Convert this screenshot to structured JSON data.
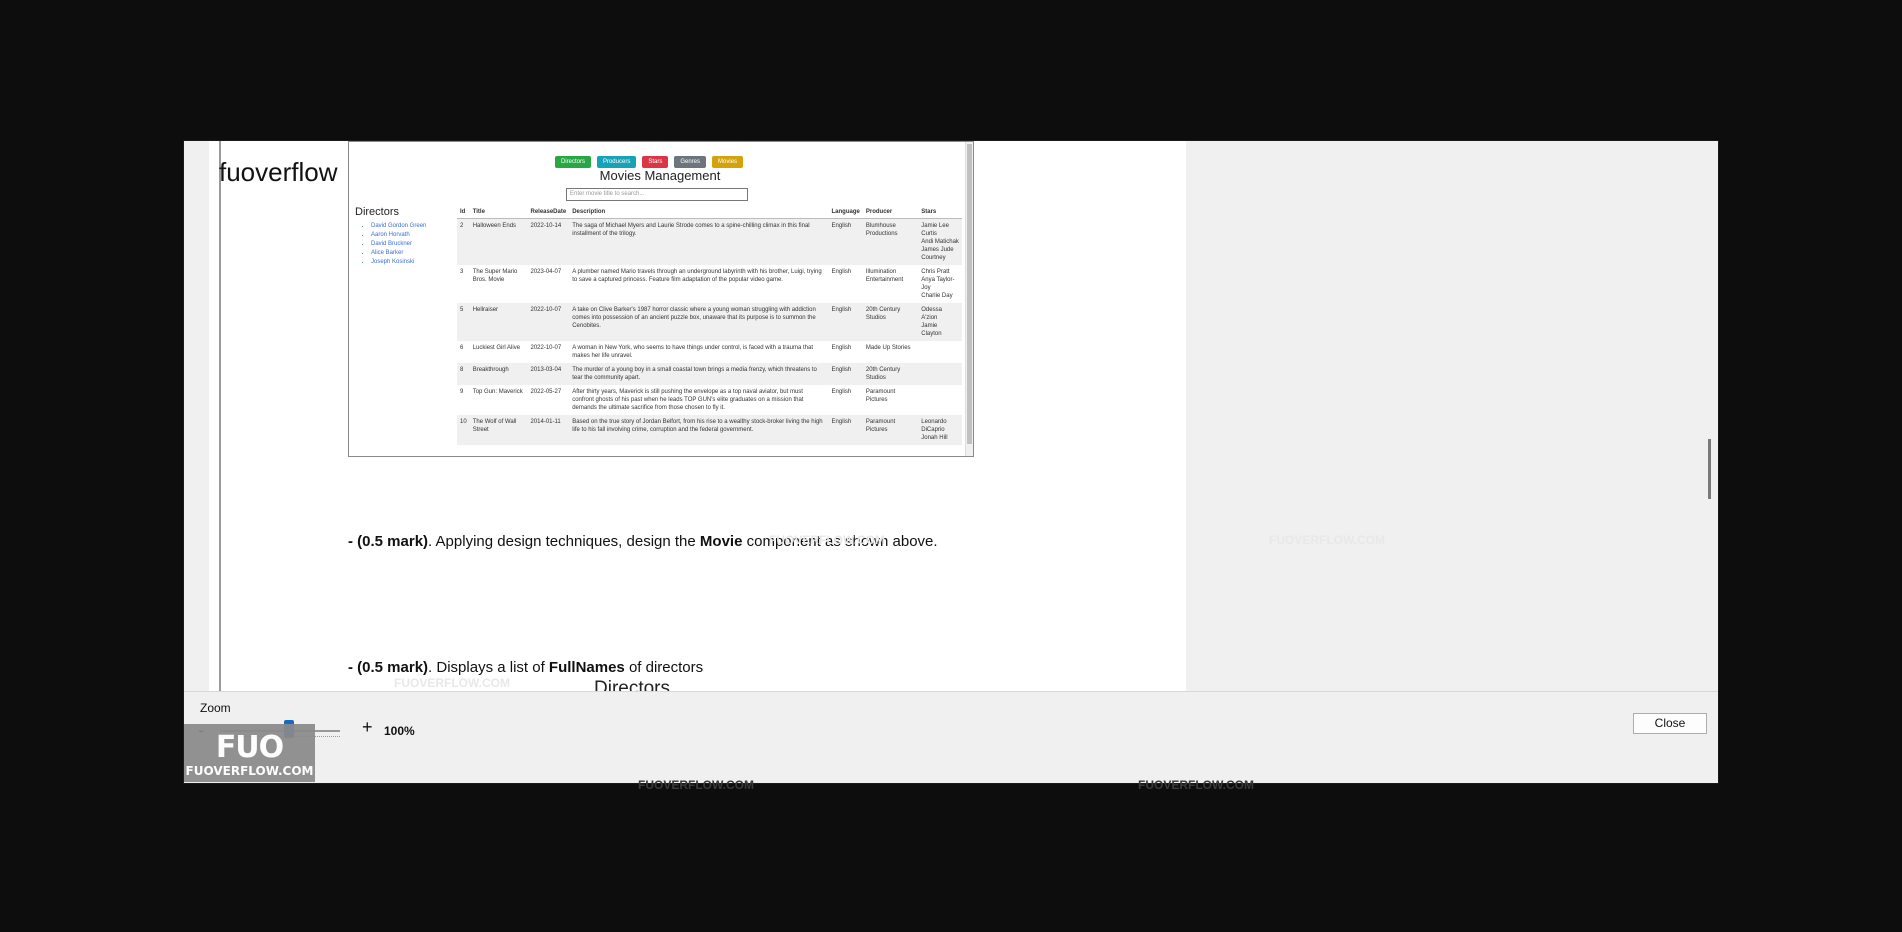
{
  "app": {
    "title": "fuoverflow"
  },
  "screenshot": {
    "nav_buttons": [
      {
        "label": "Directors",
        "color": "#28a745"
      },
      {
        "label": "Producers",
        "color": "#17a2b8"
      },
      {
        "label": "Stars",
        "color": "#dc3545"
      },
      {
        "label": "Genres",
        "color": "#6c757d"
      },
      {
        "label": "Movies",
        "color": "#d4a20b"
      }
    ],
    "heading": "Movies Management",
    "search_placeholder": "Enter movie title to search...",
    "sidebar_title": "Directors",
    "sidebar_items": [
      "David Gordon Green",
      "Aaron Horvath",
      "David Bruckner",
      "Alice Barker",
      "Joseph Kosinski"
    ],
    "columns": [
      "Id",
      "Title",
      "ReleaseDate",
      "Description",
      "Language",
      "Producer",
      "Stars"
    ],
    "rows": [
      [
        "2",
        "Halloween Ends",
        "2022-10-14",
        "The saga of Michael Myers and Laurie Strode comes to a spine-chilling climax in this final installment of the trilogy.",
        "English",
        "Blumhouse Productions",
        "Jamie Lee Curtis\nAndi Matichak\nJames Jude Courtney"
      ],
      [
        "3",
        "The Super Mario Bros. Movie",
        "2023-04-07",
        "A plumber named Mario travels through an underground labyrinth with his brother, Luigi, trying to save a captured princess. Feature film adaptation of the popular video game.",
        "English",
        "Illumination Entertainment",
        "Chris Pratt\nAnya Taylor-Joy\nCharlie Day"
      ],
      [
        "5",
        "Hellraiser",
        "2022-10-07",
        "A take on Clive Barker's 1987 horror classic where a young woman struggling with addiction comes into possession of an ancient puzzle box, unaware that its purpose is to summon the Cenobites.",
        "English",
        "20th Century Studios",
        "Odessa A'zion\nJamie Clayton"
      ],
      [
        "6",
        "Luckiest Girl Alive",
        "2022-10-07",
        "A woman in New York, who seems to have things under control, is faced with a trauma that makes her life unravel.",
        "English",
        "Made Up Stories",
        ""
      ],
      [
        "8",
        "Breakthrough",
        "2013-03-04",
        "The murder of a young boy in a small coastal town brings a media frenzy, which threatens to tear the community apart.",
        "English",
        "20th Century Studios",
        ""
      ],
      [
        "9",
        "Top Gun: Maverick",
        "2022-05-27",
        "After thirty years, Maverick is still pushing the envelope as a top naval aviator, but must confront ghosts of his past when he leads TOP GUN's elite graduates on a mission that demands the ultimate sacrifice from those chosen to fly it.",
        "English",
        "Paramount Pictures",
        ""
      ],
      [
        "10",
        "The Wolf of Wall Street",
        "2014-01-11",
        "Based on the true story of Jordan Belfort, from his rise to a wealthy stock-broker living the high life to his fall involving crime, corruption and the federal government.",
        "English",
        "Paramount Pictures",
        "Leonardo DiCaprio\nJonah Hill"
      ]
    ]
  },
  "paragraphs": [
    {
      "mark": "- (0.5 mark)",
      "pre": ". Applying design techniques, design the ",
      "bold": "Movie",
      "post": " component as shown above."
    },
    {
      "mark": "- (0.5 mark)",
      "pre": ". Displays a list of ",
      "bold": "FullNames",
      "post": " of directors"
    }
  ],
  "next_heading": "Directors",
  "watermark_text": "FUOVERFLOW.COM",
  "zoom": {
    "label": "Zoom",
    "minus": "-",
    "plus": "+",
    "value": "100%",
    "level_percent": 100
  },
  "close_label": "Close",
  "logo": {
    "mark": "FUO",
    "text": "FUOVERFLOW.COM"
  }
}
